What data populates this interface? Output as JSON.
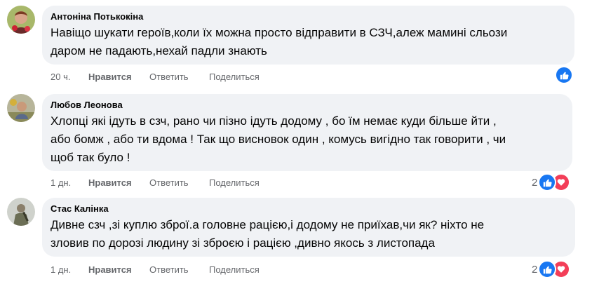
{
  "comments": [
    {
      "author": "Антоніна Потькокіна",
      "text_lines": [
        "Навіщо шукати героїв,коли їх можна просто відправити в СЗЧ,алеж мамині сльози",
        "даром не падають,нехай падли знають"
      ],
      "time": "20 ч.",
      "like_label": "Нравится",
      "reply_label": "Ответить",
      "share_label": "Поделиться",
      "reactions": [
        "like"
      ],
      "reaction_count": ""
    },
    {
      "author": "Любов Леонова",
      "text_lines": [
        "Хлопці які ідуть в сзч, рано чи пізно ідуть додому , бо їм немає куди більше йти ,",
        "або бомж , або ти вдома ! Так що висновок один , комусь вигідно так говорити , чи",
        "щоб так було !"
      ],
      "time": "1 дн.",
      "like_label": "Нравится",
      "reply_label": "Ответить",
      "share_label": "Поделиться",
      "reactions": [
        "like",
        "love"
      ],
      "reaction_count": "2"
    },
    {
      "author": "Стас Калінка",
      "text_lines": [
        "Дивне сзч ,зі куплю зброї.а головне рацією,і додому не приїхав,чи як? ніхто не",
        "зловив по дорозі людину зі зброєю і рацією ,дивно якось з листопада"
      ],
      "time": "1 дн.",
      "like_label": "Нравится",
      "reply_label": "Ответить",
      "share_label": "Поделиться",
      "reactions": [
        "like",
        "love"
      ],
      "reaction_count": "2"
    }
  ],
  "colors": {
    "bubble": "#f0f2f5",
    "meta_text": "#65676b",
    "like_blue": "#1877f2",
    "love_red": "#f33e58"
  },
  "icons": {
    "like": "thumbs-up-icon",
    "love": "heart-icon"
  }
}
